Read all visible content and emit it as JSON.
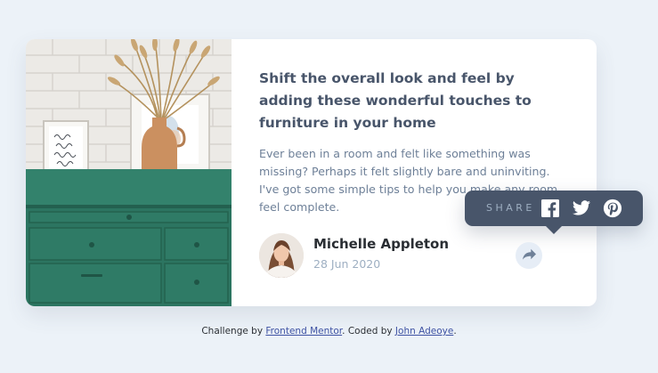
{
  "article": {
    "headline": "Shift the overall look and feel by adding these wonderful touches to furniture in your home",
    "description": "Ever been in a room and felt like something was missing? Perhaps it felt slightly bare and uninviting. I've got some simple tips to help you make any room feel complete.",
    "image_icon": "drawers-photo"
  },
  "author": {
    "name": "Michelle Appleton",
    "date": "28 Jun 2020",
    "avatar_icon": "avatar-photo"
  },
  "share": {
    "label": "SHARE",
    "toggle_icon": "share-arrow-icon",
    "networks": [
      {
        "name": "facebook",
        "icon": "facebook-icon"
      },
      {
        "name": "twitter",
        "icon": "twitter-icon"
      },
      {
        "name": "pinterest",
        "icon": "pinterest-icon"
      }
    ]
  },
  "footer": {
    "prefix": "Challenge by ",
    "link1": "Frontend Mentor",
    "middle": ". Coded by ",
    "link2": "John Adeoye",
    "suffix": "."
  },
  "colors": {
    "page_bg": "#ecf2f8",
    "heading": "#48556a",
    "body_text": "#6e8098",
    "tooltip_bg": "#48556a",
    "share_button_bg": "#e6edf6"
  }
}
